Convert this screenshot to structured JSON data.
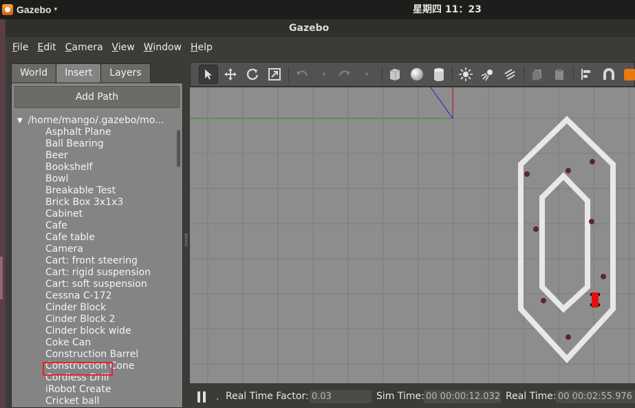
{
  "topbar": {
    "app_name": "Gazebo",
    "caret": "▾",
    "clock": "星期四 11：23"
  },
  "window": {
    "title": "Gazebo"
  },
  "menu": [
    {
      "label_u": "F",
      "label_rest": "ile"
    },
    {
      "label_u": "E",
      "label_rest": "dit"
    },
    {
      "label_u": "C",
      "label_rest": "amera"
    },
    {
      "label_u": "V",
      "label_rest": "iew"
    },
    {
      "label_u": "W",
      "label_rest": "indow"
    },
    {
      "label_u": "H",
      "label_rest": "elp"
    }
  ],
  "tabs": {
    "world": "World",
    "insert": "Insert",
    "layers": "Layers"
  },
  "insert": {
    "add_path": "Add Path",
    "root_path": "/home/mango/.gazebo/mo...",
    "models": [
      "Asphalt Plane",
      "Ball Bearing",
      "Beer",
      "Bookshelf",
      "Bowl",
      "Breakable Test",
      "Brick Box 3x1x3",
      "Cabinet",
      "Cafe",
      "Cafe table",
      "Camera",
      "Cart: front steering",
      "Cart: rigid suspension",
      "Cart: soft suspension",
      "Cessna C-172",
      "Cinder Block",
      "Cinder Block 2",
      "Cinder block wide",
      "Coke Can",
      "Construction Barrel",
      "Construction Cone",
      "Cordless Drill",
      "iRobot Create",
      "Cricket ball"
    ]
  },
  "toolbar": {
    "icons": [
      "select-arrow-icon",
      "translate-icon",
      "rotate-icon",
      "scale-icon",
      "undo-icon",
      "undo-dropdown-icon",
      "redo-icon",
      "redo-dropdown-icon",
      "box-icon",
      "sphere-icon",
      "cylinder-icon",
      "point-light-icon",
      "spot-light-icon",
      "directional-light-icon",
      "copy-icon",
      "paste-icon",
      "align-icon",
      "snap-icon",
      "view-angle-icon"
    ]
  },
  "status": {
    "rtf_label": "Real Time Factor:",
    "rtf_value": "0.03",
    "sim_label": "Sim Time:",
    "sim_value": "00 00:00:12.032",
    "real_label": "Real Time:",
    "real_value": "00 00:02:55.976",
    "step_mark": "."
  },
  "colors": {
    "viewport_bg": "#8d8d8d",
    "grid_line": "#7a7a7a",
    "track_wall": "#e8e8e8",
    "obstacle": "#5a2a28",
    "robot": "#e01010",
    "highlight": "#e8202a"
  }
}
